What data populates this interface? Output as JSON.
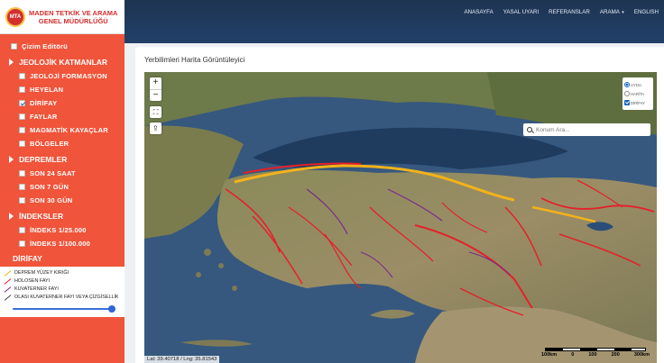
{
  "brand": {
    "badge": "MTA",
    "line1": "MADEN TETKİK VE ARAMA",
    "line2": "GENEL MÜDÜRLÜĞÜ"
  },
  "nav": {
    "items": [
      "ANASAYFA",
      "YASAL UYARI",
      "REFERANSLAR",
      "ARAMA",
      "ENGLISH"
    ]
  },
  "sidebar": {
    "drawing_editor": "Çizim Editörü",
    "geology": {
      "title": "JEOLOJİK KATMANLAR",
      "items": [
        {
          "label": "JEOLOJİ FORMASYON",
          "checked": false
        },
        {
          "label": "HEYELAN",
          "checked": false
        },
        {
          "label": "DİRİFAY",
          "checked": true
        },
        {
          "label": "FAYLAR",
          "checked": false
        },
        {
          "label": "MAGMATİK KAYAÇLAR",
          "checked": false
        },
        {
          "label": "BÖLGELER",
          "checked": false
        }
      ]
    },
    "earthquakes": {
      "title": "DEPREMLER",
      "items": [
        "SON 24 SAAT",
        "SON 7 GÜN",
        "SON 30 GÜN"
      ]
    },
    "indexes": {
      "title": "İNDEKSLER",
      "items": [
        "İNDEKS 1/25.000",
        "İNDEKS 1/100.000"
      ]
    },
    "dirifay_title": "DİRİFAY",
    "legend": [
      {
        "label": "DEPREM YÜZEY KIRIĞI",
        "color": "#f3b21b"
      },
      {
        "label": "HOLOSEN FAYI",
        "color": "#e5202a"
      },
      {
        "label": "KUVATERNER FAYI",
        "color": "#7b2a8a"
      },
      {
        "label": "OLASI KUVATERNER FAYI VEYA ÇİZGİSELLİK",
        "color": "#444444"
      }
    ],
    "opacity": 1.0
  },
  "card": {
    "title": "Yerbilimleri Harita Görüntüleyici"
  },
  "map": {
    "zoom_in": "+",
    "zoom_out": "−",
    "basemaps": [
      "UYDU",
      "HARİTA"
    ],
    "selected_basemap": "UYDU",
    "overlay": "DİRİFAY",
    "search_placeholder": "Konum Ara...",
    "coords": "Lat: 39.40718 / Lng: 35.81543",
    "scale_labels": [
      "100km",
      "0",
      "100",
      "200",
      "300km"
    ]
  }
}
